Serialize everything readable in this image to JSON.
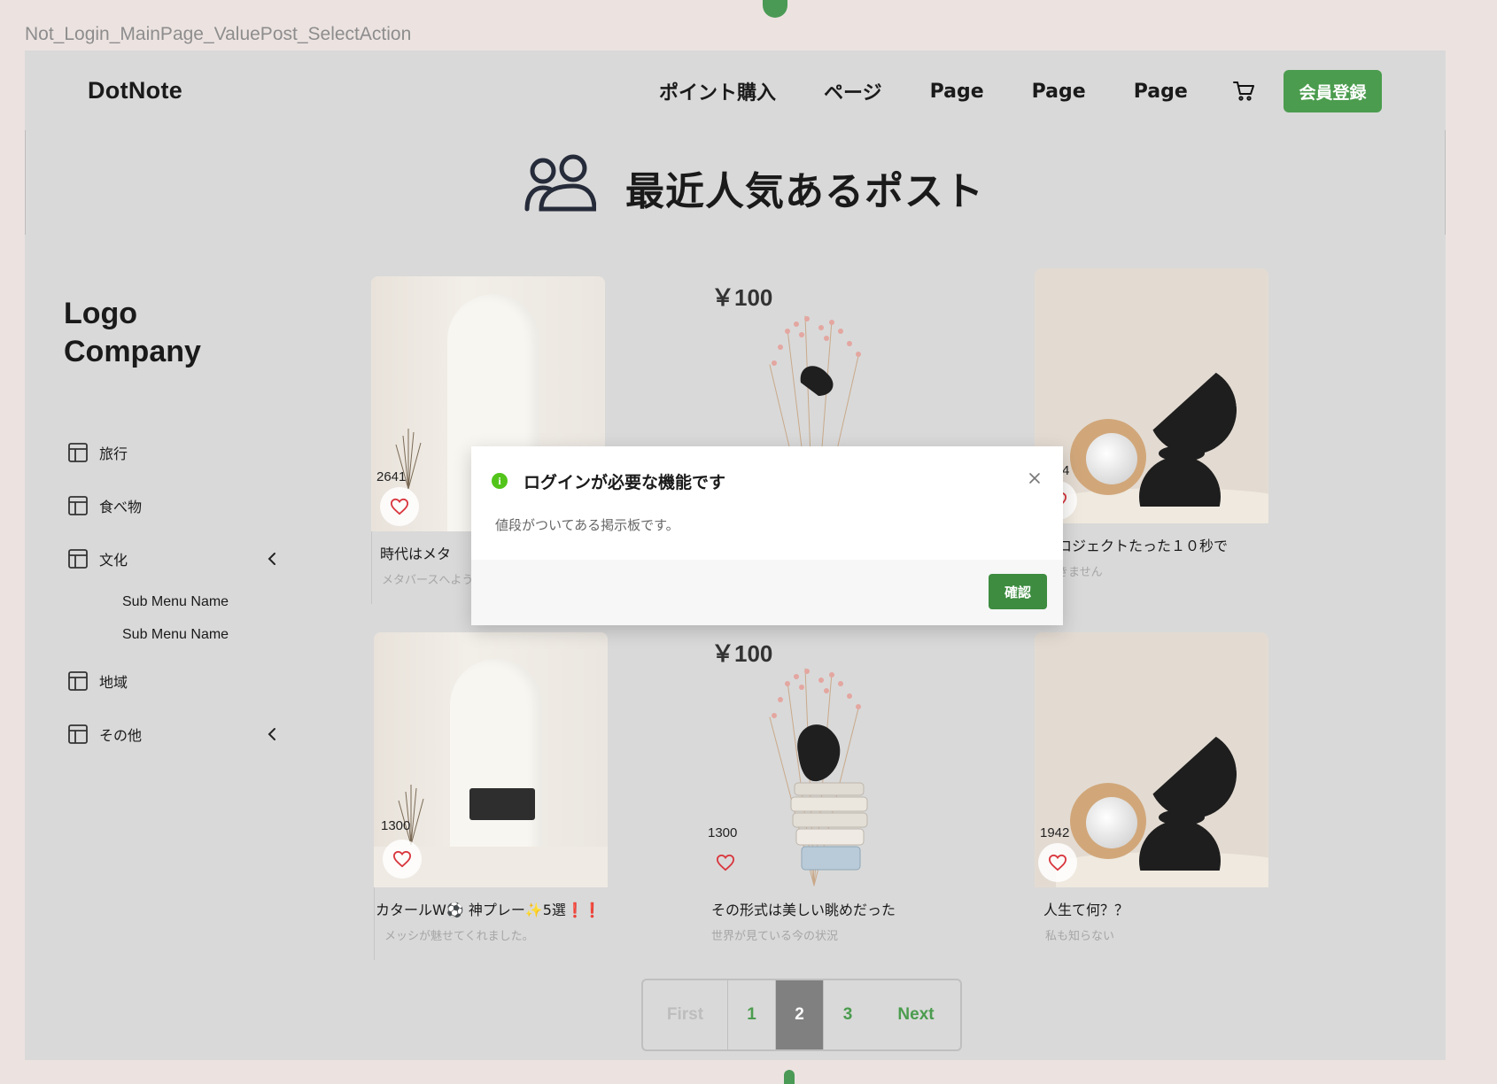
{
  "frame_label": "Not_Login_MainPage_ValuePost_SelectAction",
  "header": {
    "brand": "DotNote",
    "nav": [
      "ポイント購入",
      "ページ",
      "Page",
      "Page",
      "Page"
    ],
    "cart_icon": "cart-icon",
    "signup_label": "会員登録",
    "accent_color": "#4b9c4e"
  },
  "hero": {
    "icon": "users-icon",
    "title": "最近人気あるポスト"
  },
  "sidebar": {
    "logo_line1": "Logo",
    "logo_line2": "Company",
    "items": [
      {
        "label": "旅行",
        "icon": "layout-icon"
      },
      {
        "label": "食べ物",
        "icon": "layout-icon"
      },
      {
        "label": "文化",
        "icon": "layout-icon",
        "expanded": true,
        "sub": [
          "Sub Menu Name",
          "Sub Menu Name"
        ]
      },
      {
        "label": "地域",
        "icon": "layout-icon"
      },
      {
        "label": "その他",
        "icon": "layout-icon"
      }
    ]
  },
  "posts": [
    {
      "count": "2641",
      "title": "時代はメタ",
      "subtitle": "メタバースへようこそ"
    },
    {
      "price": "￥100"
    },
    {
      "count": "8274",
      "title": "プロジェクトたった１０秒で",
      "subtitle": "できません"
    },
    {
      "count": "1300",
      "title": "カタールW⚽ 神プレー✨5選",
      "title_marks": "❗❗",
      "subtitle": "メッシが魅せてくれました。"
    },
    {
      "price": "￥100",
      "count": "1300",
      "title": "その形式は美しい眺めだった",
      "subtitle": "世界が見ている今の状況"
    },
    {
      "count": "1942",
      "title": "人生て何？？",
      "subtitle": "私も知らない"
    }
  ],
  "pagination": {
    "first": "First",
    "pages": [
      "1",
      "2",
      "3"
    ],
    "current": "2",
    "next": "Next"
  },
  "modal": {
    "icon": "info-icon",
    "icon_glyph": "i",
    "title": "ログインが必要な機能です",
    "body": "値段がついてある掲示板です。",
    "confirm": "確認",
    "close_icon": "close-icon"
  }
}
